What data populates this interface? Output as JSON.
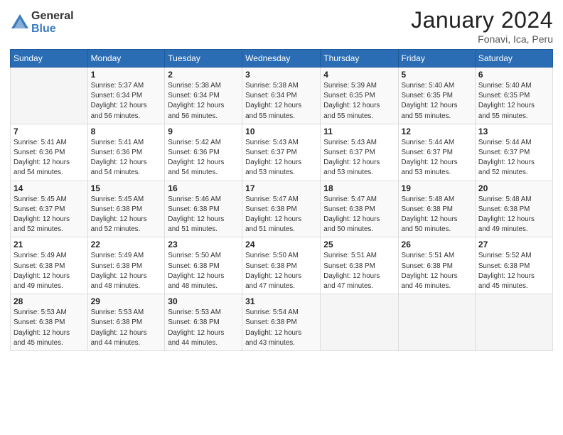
{
  "logo": {
    "general": "General",
    "blue": "Blue"
  },
  "header": {
    "title": "January 2024",
    "location": "Fonavi, Ica, Peru"
  },
  "weekdays": [
    "Sunday",
    "Monday",
    "Tuesday",
    "Wednesday",
    "Thursday",
    "Friday",
    "Saturday"
  ],
  "weeks": [
    [
      {
        "day": "",
        "info": ""
      },
      {
        "day": "1",
        "info": "Sunrise: 5:37 AM\nSunset: 6:34 PM\nDaylight: 12 hours\nand 56 minutes."
      },
      {
        "day": "2",
        "info": "Sunrise: 5:38 AM\nSunset: 6:34 PM\nDaylight: 12 hours\nand 56 minutes."
      },
      {
        "day": "3",
        "info": "Sunrise: 5:38 AM\nSunset: 6:34 PM\nDaylight: 12 hours\nand 55 minutes."
      },
      {
        "day": "4",
        "info": "Sunrise: 5:39 AM\nSunset: 6:35 PM\nDaylight: 12 hours\nand 55 minutes."
      },
      {
        "day": "5",
        "info": "Sunrise: 5:40 AM\nSunset: 6:35 PM\nDaylight: 12 hours\nand 55 minutes."
      },
      {
        "day": "6",
        "info": "Sunrise: 5:40 AM\nSunset: 6:35 PM\nDaylight: 12 hours\nand 55 minutes."
      }
    ],
    [
      {
        "day": "7",
        "info": "Sunrise: 5:41 AM\nSunset: 6:36 PM\nDaylight: 12 hours\nand 54 minutes."
      },
      {
        "day": "8",
        "info": "Sunrise: 5:41 AM\nSunset: 6:36 PM\nDaylight: 12 hours\nand 54 minutes."
      },
      {
        "day": "9",
        "info": "Sunrise: 5:42 AM\nSunset: 6:36 PM\nDaylight: 12 hours\nand 54 minutes."
      },
      {
        "day": "10",
        "info": "Sunrise: 5:43 AM\nSunset: 6:37 PM\nDaylight: 12 hours\nand 53 minutes."
      },
      {
        "day": "11",
        "info": "Sunrise: 5:43 AM\nSunset: 6:37 PM\nDaylight: 12 hours\nand 53 minutes."
      },
      {
        "day": "12",
        "info": "Sunrise: 5:44 AM\nSunset: 6:37 PM\nDaylight: 12 hours\nand 53 minutes."
      },
      {
        "day": "13",
        "info": "Sunrise: 5:44 AM\nSunset: 6:37 PM\nDaylight: 12 hours\nand 52 minutes."
      }
    ],
    [
      {
        "day": "14",
        "info": "Sunrise: 5:45 AM\nSunset: 6:37 PM\nDaylight: 12 hours\nand 52 minutes."
      },
      {
        "day": "15",
        "info": "Sunrise: 5:45 AM\nSunset: 6:38 PM\nDaylight: 12 hours\nand 52 minutes."
      },
      {
        "day": "16",
        "info": "Sunrise: 5:46 AM\nSunset: 6:38 PM\nDaylight: 12 hours\nand 51 minutes."
      },
      {
        "day": "17",
        "info": "Sunrise: 5:47 AM\nSunset: 6:38 PM\nDaylight: 12 hours\nand 51 minutes."
      },
      {
        "day": "18",
        "info": "Sunrise: 5:47 AM\nSunset: 6:38 PM\nDaylight: 12 hours\nand 50 minutes."
      },
      {
        "day": "19",
        "info": "Sunrise: 5:48 AM\nSunset: 6:38 PM\nDaylight: 12 hours\nand 50 minutes."
      },
      {
        "day": "20",
        "info": "Sunrise: 5:48 AM\nSunset: 6:38 PM\nDaylight: 12 hours\nand 49 minutes."
      }
    ],
    [
      {
        "day": "21",
        "info": "Sunrise: 5:49 AM\nSunset: 6:38 PM\nDaylight: 12 hours\nand 49 minutes."
      },
      {
        "day": "22",
        "info": "Sunrise: 5:49 AM\nSunset: 6:38 PM\nDaylight: 12 hours\nand 48 minutes."
      },
      {
        "day": "23",
        "info": "Sunrise: 5:50 AM\nSunset: 6:38 PM\nDaylight: 12 hours\nand 48 minutes."
      },
      {
        "day": "24",
        "info": "Sunrise: 5:50 AM\nSunset: 6:38 PM\nDaylight: 12 hours\nand 47 minutes."
      },
      {
        "day": "25",
        "info": "Sunrise: 5:51 AM\nSunset: 6:38 PM\nDaylight: 12 hours\nand 47 minutes."
      },
      {
        "day": "26",
        "info": "Sunrise: 5:51 AM\nSunset: 6:38 PM\nDaylight: 12 hours\nand 46 minutes."
      },
      {
        "day": "27",
        "info": "Sunrise: 5:52 AM\nSunset: 6:38 PM\nDaylight: 12 hours\nand 45 minutes."
      }
    ],
    [
      {
        "day": "28",
        "info": "Sunrise: 5:53 AM\nSunset: 6:38 PM\nDaylight: 12 hours\nand 45 minutes."
      },
      {
        "day": "29",
        "info": "Sunrise: 5:53 AM\nSunset: 6:38 PM\nDaylight: 12 hours\nand 44 minutes."
      },
      {
        "day": "30",
        "info": "Sunrise: 5:53 AM\nSunset: 6:38 PM\nDaylight: 12 hours\nand 44 minutes."
      },
      {
        "day": "31",
        "info": "Sunrise: 5:54 AM\nSunset: 6:38 PM\nDaylight: 12 hours\nand 43 minutes."
      },
      {
        "day": "",
        "info": ""
      },
      {
        "day": "",
        "info": ""
      },
      {
        "day": "",
        "info": ""
      }
    ]
  ]
}
